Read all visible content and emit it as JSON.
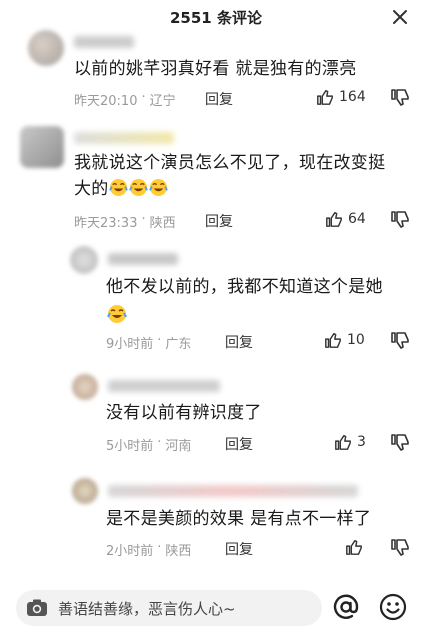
{
  "header": {
    "title": "2551 条评论"
  },
  "comments": [
    {
      "text": "以前的姚芊羽真好看 就是独有的漂亮",
      "time": "昨天20:10",
      "location": "辽宁",
      "reply": "回复",
      "likes": "164"
    },
    {
      "text_line1": "我就说这个演员怎么不见了，现在改变挺",
      "text_line2": "大的",
      "time": "昨天23:33",
      "location": "陕西",
      "reply": "回复",
      "likes": "64"
    },
    {
      "text": "他不发以前的，我都不知道这个是她",
      "time": "9小时前",
      "location": "广东",
      "reply": "回复",
      "likes": "10"
    },
    {
      "text": "没有以前有辨识度了",
      "time": "5小时前",
      "location": "河南",
      "reply": "回复",
      "likes": "3"
    },
    {
      "text": "是不是美颜的效果 是有点不一样了",
      "time": "2小时前",
      "location": "陕西",
      "reply": "回复",
      "likes": ""
    }
  ],
  "input": {
    "placeholder": "善语结善缘，恶言伤人心~"
  },
  "icons": {
    "close": "close-icon",
    "like": "thumb-up-icon",
    "dislike": "thumb-down-icon",
    "camera": "camera-icon",
    "at": "at-icon",
    "emoji": "smile-icon"
  },
  "colors": {
    "meta": "#9a9a9a",
    "text": "#1a1a1a",
    "input_bg": "#f2f2f2"
  }
}
